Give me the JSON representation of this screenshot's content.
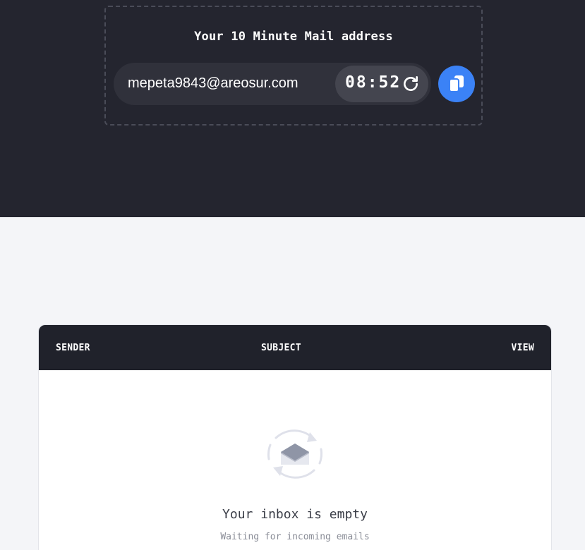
{
  "address_box": {
    "title": "Your 10 Minute Mail address",
    "email": "mepeta9843@areosur.com",
    "timer": "08:52",
    "refresh_icon": "refresh-icon",
    "copy_icon": "copy-icon"
  },
  "inbox": {
    "columns": {
      "sender": "SENDER",
      "subject": "SUBJECT",
      "view": "VIEW"
    },
    "empty_state": {
      "icon": "open-envelope-refresh-icon",
      "title": "Your inbox is empty",
      "subtitle": "Waiting for incoming emails"
    }
  },
  "colors": {
    "hero_bg": "#24252f",
    "accent": "#3b82f6",
    "page_bg": "#f4f5f8",
    "table_header_bg": "#20222b"
  }
}
